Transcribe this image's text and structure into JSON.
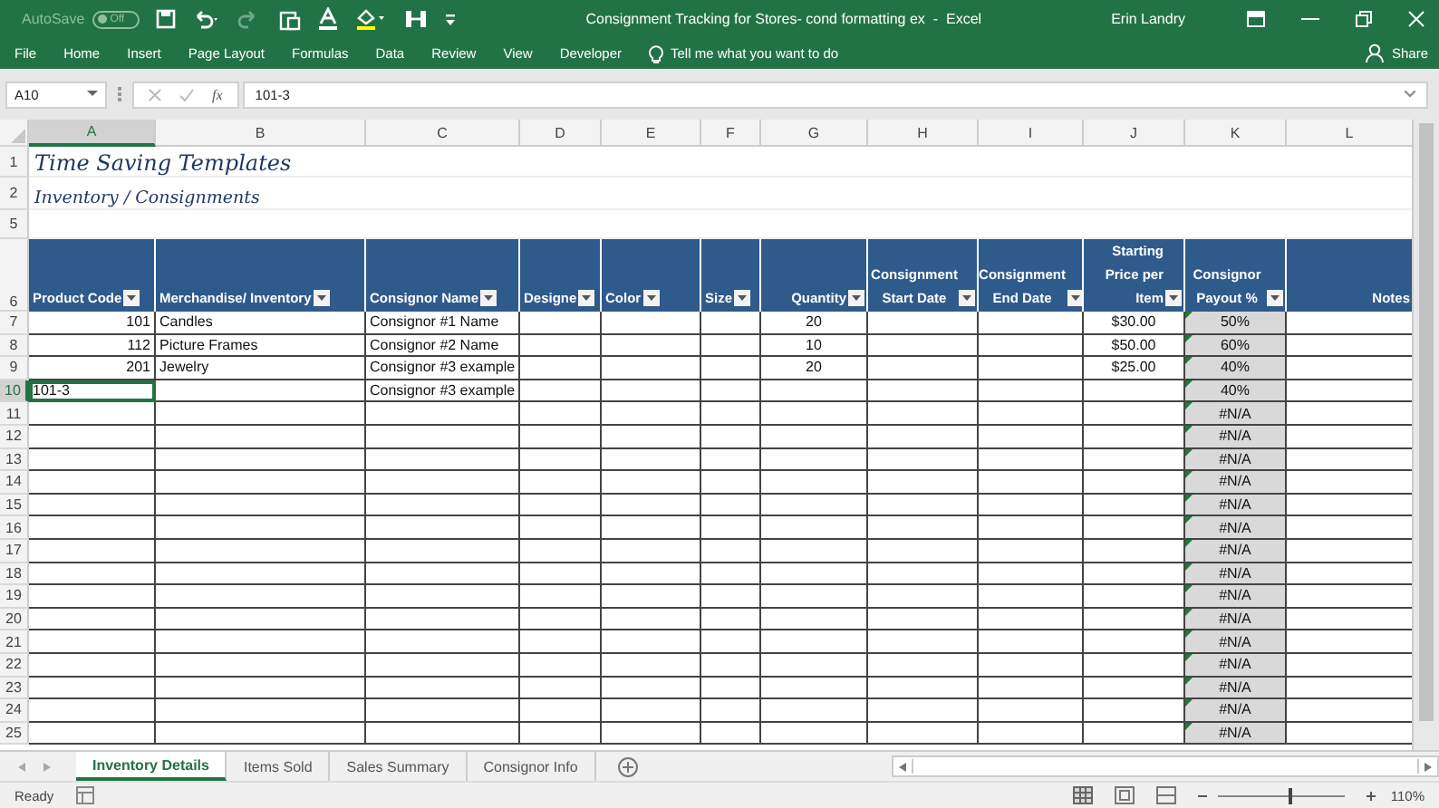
{
  "window": {
    "title": "Consignment Tracking for Stores- cond formatting ex  -  Excel",
    "user": "Erin Landry"
  },
  "autosave": {
    "label": "AutoSave",
    "state": "Off",
    "on": false
  },
  "ribbon_tabs": [
    "File",
    "Home",
    "Insert",
    "Page Layout",
    "Formulas",
    "Data",
    "Review",
    "View",
    "Developer"
  ],
  "tell_me": "Tell me what you want to do",
  "share": "Share",
  "formula_bar": {
    "name_box": "A10",
    "function_label": "fx",
    "formula": "101-3"
  },
  "columns": [
    {
      "label": "A",
      "selected": true
    },
    {
      "label": "B",
      "selected": false
    },
    {
      "label": "C",
      "selected": false
    },
    {
      "label": "D",
      "selected": false
    },
    {
      "label": "E",
      "selected": false
    },
    {
      "label": "F",
      "selected": false
    },
    {
      "label": "G",
      "selected": false
    },
    {
      "label": "H",
      "selected": false
    },
    {
      "label": "I",
      "selected": false
    },
    {
      "label": "J",
      "selected": false
    },
    {
      "label": "K",
      "selected": false
    },
    {
      "label": "L",
      "selected": false
    }
  ],
  "sheet_title": {
    "row": "1",
    "text": "Time Saving Templates"
  },
  "sheet_subtitle": {
    "row": "2",
    "text": "Inventory / Consignments"
  },
  "blank_row": "5",
  "table": {
    "row": "6",
    "headers": [
      "Product Code",
      "Merchandise/ Inventory",
      "Consignor Name",
      "Designe",
      "Color",
      "Size",
      "Quantity",
      "Consignment Start Date",
      "Consignment End Date",
      "Starting Price per Item",
      "Consignor Payout %",
      "Notes"
    ],
    "rows": [
      {
        "row": "7",
        "selected": false,
        "product_code": "101",
        "merchandise": "Candles",
        "consignor_name": "Consignor #1 Name",
        "quantity": "20",
        "price": "$30.00",
        "payout": "50%"
      },
      {
        "row": "8",
        "selected": false,
        "product_code": "112",
        "merchandise": "Picture Frames",
        "consignor_name": "Consignor #2 Name",
        "quantity": "10",
        "price": "$50.00",
        "payout": "60%"
      },
      {
        "row": "9",
        "selected": false,
        "product_code": "201",
        "merchandise": "Jewelry",
        "consignor_name": "Consignor #3 example",
        "quantity": "20",
        "price": "$25.00",
        "payout": "40%"
      },
      {
        "row": "10",
        "selected": true,
        "product_code": "101-3",
        "consignor_name": "Consignor #3 example",
        "payout": "40%"
      },
      {
        "row": "11",
        "selected": false,
        "payout": "#N/A"
      },
      {
        "row": "12",
        "selected": false,
        "payout": "#N/A"
      },
      {
        "row": "13",
        "selected": false,
        "payout": "#N/A"
      },
      {
        "row": "14",
        "selected": false,
        "payout": "#N/A"
      },
      {
        "row": "15",
        "selected": false,
        "payout": "#N/A"
      },
      {
        "row": "16",
        "selected": false,
        "payout": "#N/A"
      },
      {
        "row": "17",
        "selected": false,
        "payout": "#N/A"
      },
      {
        "row": "18",
        "selected": false,
        "payout": "#N/A"
      },
      {
        "row": "19",
        "selected": false,
        "payout": "#N/A"
      },
      {
        "row": "20",
        "selected": false,
        "payout": "#N/A"
      },
      {
        "row": "21",
        "selected": false,
        "payout": "#N/A"
      },
      {
        "row": "22",
        "selected": false,
        "payout": "#N/A"
      },
      {
        "row": "23",
        "selected": false,
        "payout": "#N/A"
      },
      {
        "row": "24",
        "selected": false,
        "payout": "#N/A"
      },
      {
        "row": "25",
        "selected": false,
        "payout": "#N/A"
      }
    ]
  },
  "sheet_tabs": [
    {
      "label": "Inventory Details",
      "selected": true
    },
    {
      "label": "Items Sold",
      "selected": false
    },
    {
      "label": "Sales Summary",
      "selected": false
    },
    {
      "label": "Consignor Info",
      "selected": false
    }
  ],
  "status_bar": {
    "status": "Ready",
    "zoom": {
      "level": 0.55,
      "reading": "110%"
    }
  }
}
